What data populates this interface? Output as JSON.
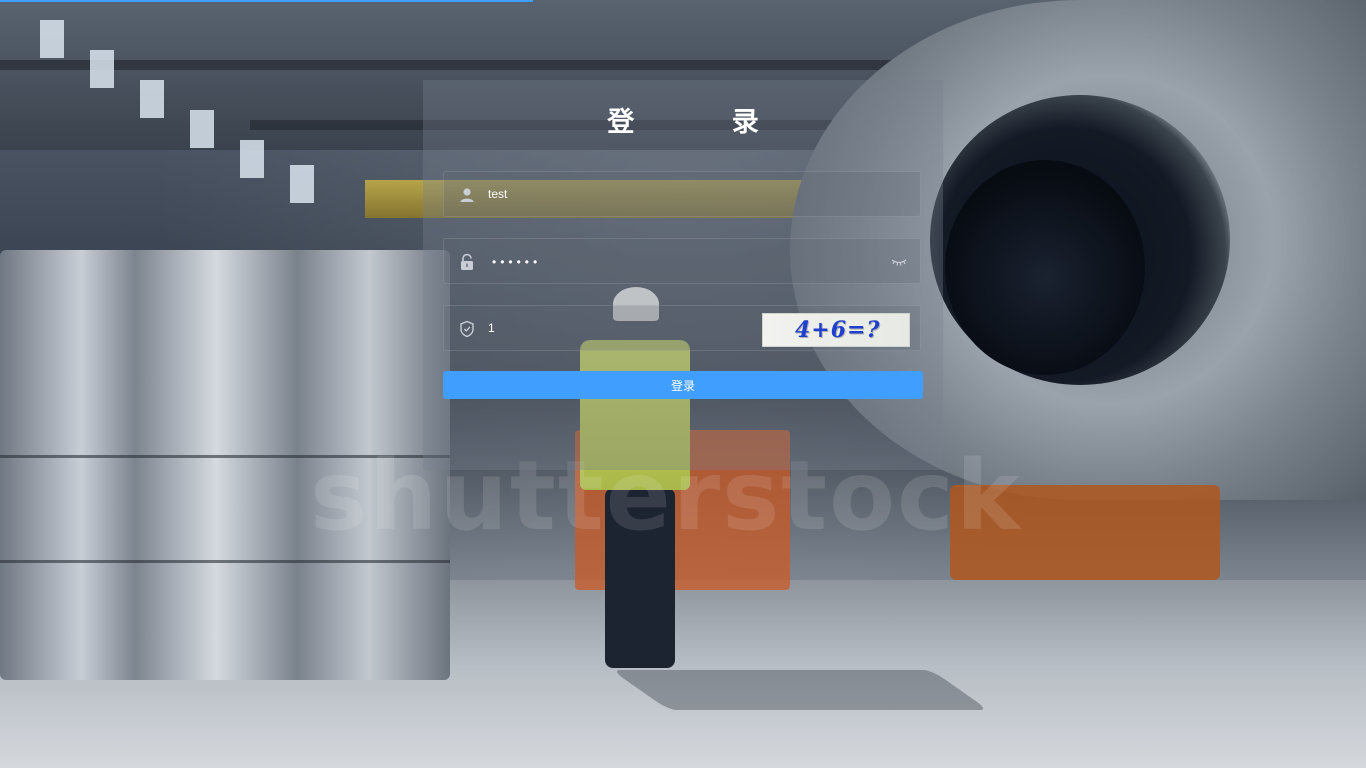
{
  "background": {
    "description_icon": "factory-background-image",
    "watermark": "shutterstock"
  },
  "top_progress": {
    "value_percent": 39,
    "color": "#409eff"
  },
  "login": {
    "title": "登 录",
    "username": {
      "icon": "user-icon",
      "value": "test"
    },
    "password": {
      "icon": "lock-icon",
      "masked_value": "••••••",
      "toggle_icon": "eye-closed-icon"
    },
    "captcha": {
      "icon": "shield-icon",
      "value": "1",
      "image_text": "4+6=?"
    },
    "submit_label": "登录",
    "accent_color": "#409eff"
  }
}
